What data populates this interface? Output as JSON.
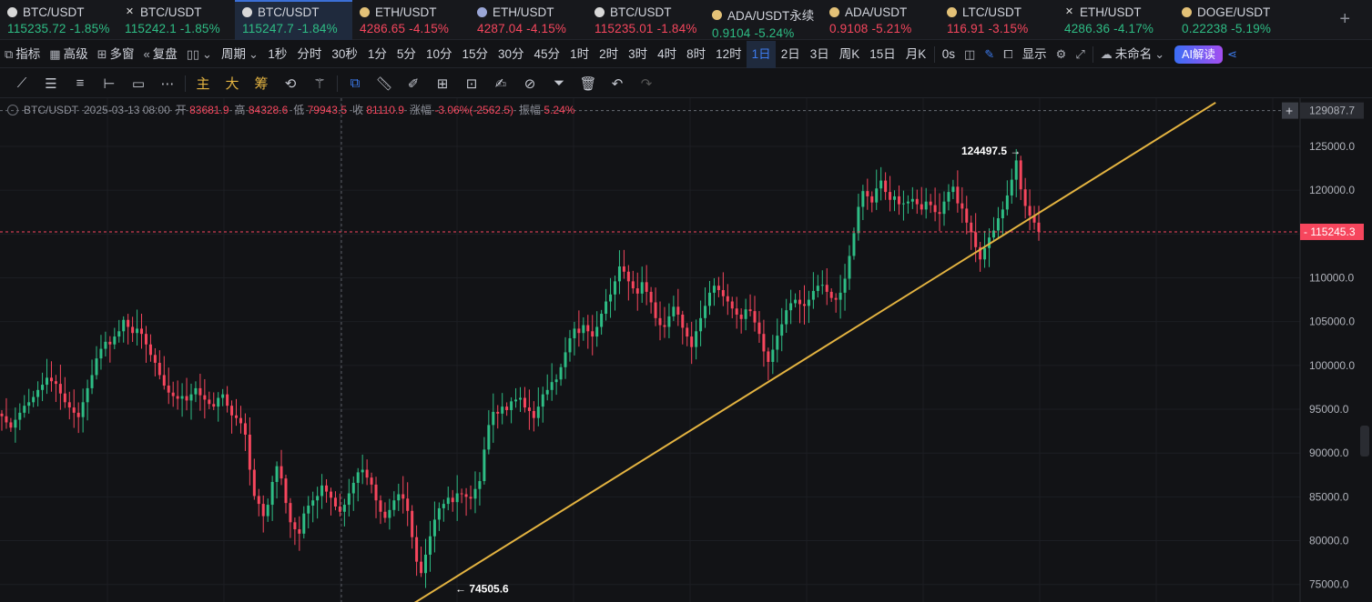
{
  "tickers": [
    {
      "symbol": "BTC/USDT",
      "icon": "btc",
      "price": "115235.72",
      "change": "-1.85%",
      "dir": "up"
    },
    {
      "symbol": "BTC/USDT",
      "icon": "x",
      "price": "115242.1",
      "change": "-1.85%",
      "dir": "up"
    },
    {
      "symbol": "BTC/USDT",
      "icon": "btc",
      "price": "115247.7",
      "change": "-1.84%",
      "dir": "up",
      "active": true
    },
    {
      "symbol": "ETH/USDT",
      "icon": "ada",
      "price": "4286.65",
      "change": "-4.15%",
      "dir": "dn"
    },
    {
      "symbol": "ETH/USDT",
      "icon": "eth",
      "price": "4287.04",
      "change": "-4.15%",
      "dir": "dn"
    },
    {
      "symbol": "BTC/USDT",
      "icon": "btc",
      "price": "115235.01",
      "change": "-1.84%",
      "dir": "dn"
    },
    {
      "symbol": "ADA/USDT永续",
      "icon": "ada",
      "price": "0.9104",
      "change": "-5.24%",
      "dir": "up"
    },
    {
      "symbol": "ADA/USDT",
      "icon": "ada",
      "price": "0.9108",
      "change": "-5.21%",
      "dir": "dn"
    },
    {
      "symbol": "LTC/USDT",
      "icon": "ada",
      "price": "116.91",
      "change": "-3.15%",
      "dir": "dn"
    },
    {
      "symbol": "ETH/USDT",
      "icon": "x",
      "price": "4286.36",
      "change": "-4.17%",
      "dir": "up"
    },
    {
      "symbol": "DOGE/USDT",
      "icon": "ada",
      "price": "0.22238",
      "change": "-5.19%",
      "dir": "up"
    }
  ],
  "add_tab": "+",
  "toolbar": {
    "indicators": "指标",
    "advanced": "高级",
    "multi_window": "多窗",
    "replay": "复盘",
    "period": "周期",
    "periods": [
      "1秒",
      "分时",
      "30秒",
      "1分",
      "5分",
      "10分",
      "15分",
      "30分",
      "45分",
      "1时",
      "2时",
      "3时",
      "4时",
      "8时",
      "12时",
      "1日",
      "2日",
      "3日",
      "周K",
      "15日",
      "月K"
    ],
    "active_period": "1日",
    "countdown": "0s",
    "display": "显示",
    "layout_name": "未命名",
    "ai": "AI解读"
  },
  "drawbar": {
    "main": "主",
    "big": "大",
    "chip": "筹"
  },
  "legend": {
    "symbol": "BTC/USDT",
    "date": "2025-03-13 08:00",
    "open_label": "开",
    "open": "83681.9",
    "high_label": "高",
    "high": "84328.6",
    "low_label": "低",
    "low": "79943.5",
    "close_label": "收",
    "close": "81110.9",
    "chg_label": "涨幅",
    "chg": "-3.06%(-2562.5)",
    "amp_label": "振幅",
    "amp": "5.24%"
  },
  "chart_data": {
    "type": "candlestick",
    "ylim": [
      73000,
      130500
    ],
    "y_ticks": [
      "129087.7",
      "125000.0",
      "120000.0",
      "115000.0",
      "110000.0",
      "105000.0",
      "100000.0",
      "95000.0",
      "90000.0",
      "85000.0",
      "80000.0",
      "75000.0"
    ],
    "current_price": "115245.3",
    "top_marker": "129087.7",
    "high_label": "124497.5",
    "low_label": "74505.6",
    "colors": {
      "up": "#2ebd85",
      "down": "#f6465d",
      "trendline": "#e3b341"
    },
    "trendline": {
      "from": [
        0.298,
        72500
      ],
      "to": [
        0.886,
        130000
      ]
    },
    "closes": [
      94200,
      93500,
      92900,
      93800,
      94600,
      95400,
      95800,
      96400,
      97200,
      97800,
      98600,
      98200,
      97900,
      96800,
      95800,
      95200,
      94600,
      94100,
      95800,
      97400,
      98900,
      100800,
      101900,
      102700,
      102400,
      103300,
      103900,
      105200,
      104400,
      103700,
      104200,
      103600,
      102400,
      101200,
      100300,
      98900,
      97700,
      96900,
      96500,
      96200,
      96500,
      96000,
      96700,
      97400,
      96600,
      96100,
      95600,
      95300,
      96300,
      96700,
      95400,
      94300,
      94000,
      93400,
      92100,
      88100,
      85100,
      84200,
      82800,
      84100,
      86700,
      88500,
      87100,
      84300,
      82100,
      81300,
      80800,
      83100,
      84000,
      84600,
      85100,
      86300,
      85600,
      84900,
      83900,
      83300,
      84100,
      85400,
      86600,
      87800,
      88100,
      87200,
      86400,
      84600,
      83300,
      82600,
      83500,
      84600,
      85300,
      84800,
      83400,
      80400,
      77600,
      76300,
      78400,
      80500,
      82400,
      83700,
      84200,
      84900,
      84400,
      85400,
      85300,
      85000,
      84800,
      85900,
      86800,
      90400,
      93200,
      94700,
      94500,
      95300,
      94900,
      95900,
      96100,
      96300,
      95200,
      94800,
      94000,
      95300,
      96700,
      97200,
      98100,
      98400,
      99800,
      101500,
      103100,
      104200,
      103700,
      104600,
      103900,
      103300,
      104400,
      105900,
      107300,
      108100,
      109600,
      111300,
      110700,
      109600,
      108800,
      108200,
      109500,
      108400,
      107200,
      105400,
      104600,
      104400,
      105600,
      106700,
      105800,
      104300,
      103300,
      102100,
      103900,
      105400,
      106800,
      108300,
      109100,
      108600,
      107900,
      107300,
      106500,
      105800,
      105300,
      106400,
      106200,
      104900,
      103600,
      101600,
      100400,
      101800,
      103400,
      104700,
      106300,
      107100,
      107500,
      107000,
      106800,
      107500,
      108500,
      109100,
      109200,
      108400,
      107700,
      107500,
      108300,
      109900,
      112500,
      115100,
      118100,
      119900,
      119300,
      118600,
      120200,
      121100,
      119800,
      118900,
      119300,
      118400,
      118500,
      118700,
      119000,
      118400,
      117800,
      118700,
      118300,
      117500,
      117300,
      118700,
      119800,
      120400,
      118500,
      117900,
      116300,
      115200,
      113500,
      112100,
      113400,
      114600,
      115400,
      116800,
      117800,
      119400,
      121200,
      123400,
      120100,
      118200,
      117100,
      116300,
      115245
    ]
  }
}
